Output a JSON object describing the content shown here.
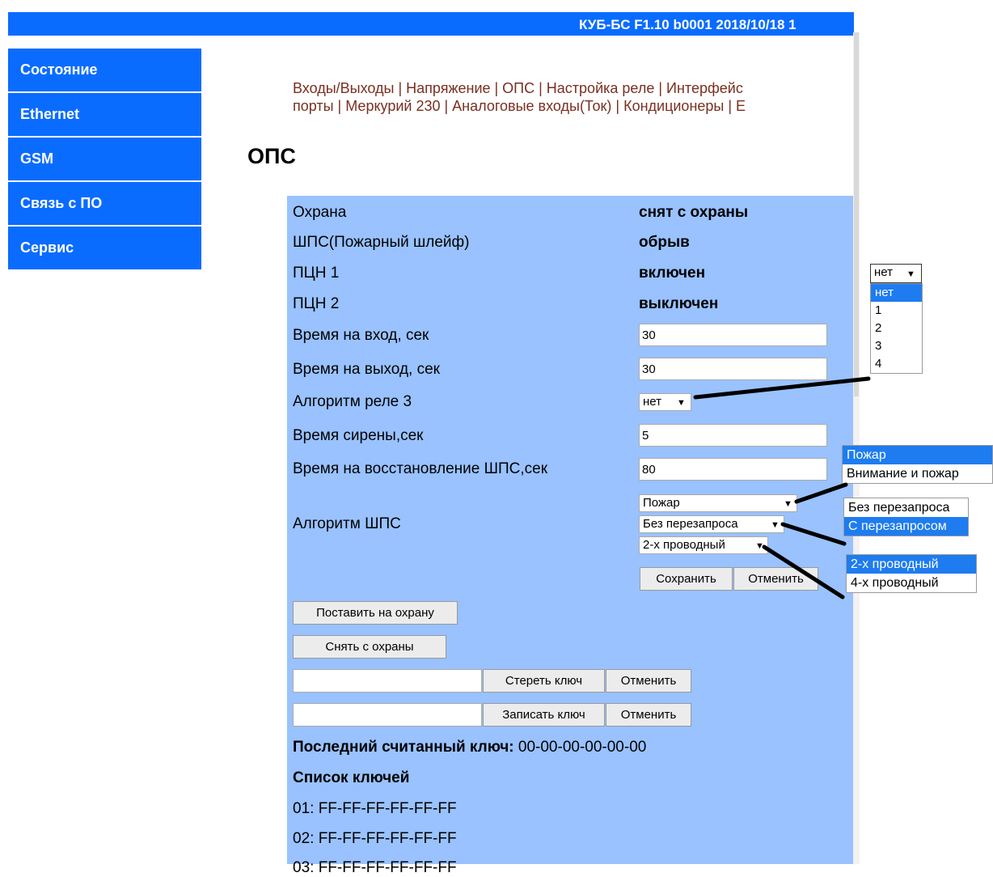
{
  "header": {
    "title": "КУБ-БС F1.10 b0001 2018/10/18 1"
  },
  "sidebar": {
    "items": [
      "Состояние",
      "Ethernet",
      "GSM",
      "Связь с ПО",
      "Сервис"
    ]
  },
  "nav": {
    "line1": "Входы/Выходы | Напряжение | ОПС | Настройка реле | Интерфейс",
    "line2": "порты | Меркурий 230 | Аналоговые входы(Ток) | Кондиционеры | E"
  },
  "page_title": "ОПС",
  "status": {
    "guard_label": "Охрана",
    "guard_value": "снят с охраны",
    "fire_loop_label": "ШПС(Пожарный шлейф)",
    "fire_loop_value": "обрыв",
    "pcn1_label": "ПЦН 1",
    "pcn1_value": "включен",
    "pcn2_label": "ПЦН 2",
    "pcn2_value": "выключен"
  },
  "settings": {
    "entry_time_label": "Время на вход, сек",
    "entry_time_value": "30",
    "exit_time_label": "Время на выход, сек",
    "exit_time_value": "30",
    "relay3_label": "Алгоритм реле 3",
    "relay3_value": "нет",
    "siren_label": "Время сирены,сек",
    "siren_value": "5",
    "restore_label": "Время на восстановление ШПС,сек",
    "restore_value": "80",
    "shps_algo_label": "Алгоритм ШПС",
    "shps_mode": "Пожар",
    "shps_request": "Без перезапроса",
    "shps_wiring": "2-х проводный"
  },
  "buttons": {
    "save": "Сохранить",
    "cancel": "Отменить",
    "arm": "Поставить на охрану",
    "disarm": "Снять с охраны",
    "erase_key": "Стереть ключ",
    "erase_cancel": "Отменить",
    "write_key": "Записать ключ",
    "write_cancel": "Отменить"
  },
  "keys": {
    "last_read_label": "Последний считанный ключ:",
    "last_read_value": "00-00-00-00-00-00",
    "list_label": "Список ключей",
    "list": [
      "01: FF-FF-FF-FF-FF-FF",
      "02: FF-FF-FF-FF-FF-FF",
      "03: FF-FF-FF-FF-FF-FF"
    ]
  },
  "popups": {
    "relay": {
      "selected": "нет",
      "options": [
        "нет",
        "1",
        "2",
        "3",
        "4"
      ]
    },
    "mode": {
      "options": [
        "Пожар",
        "Внимание и пожар"
      ]
    },
    "request": {
      "options": [
        "Без перезапроса",
        "С перезапросом"
      ]
    },
    "wiring": {
      "options": [
        "2-х проводный",
        "4-х проводный"
      ]
    }
  },
  "colors": {
    "accent": "#0a6cff",
    "panel": "#99c2ff",
    "link": "#7a2f20",
    "highlight": "#1e7cf0"
  }
}
